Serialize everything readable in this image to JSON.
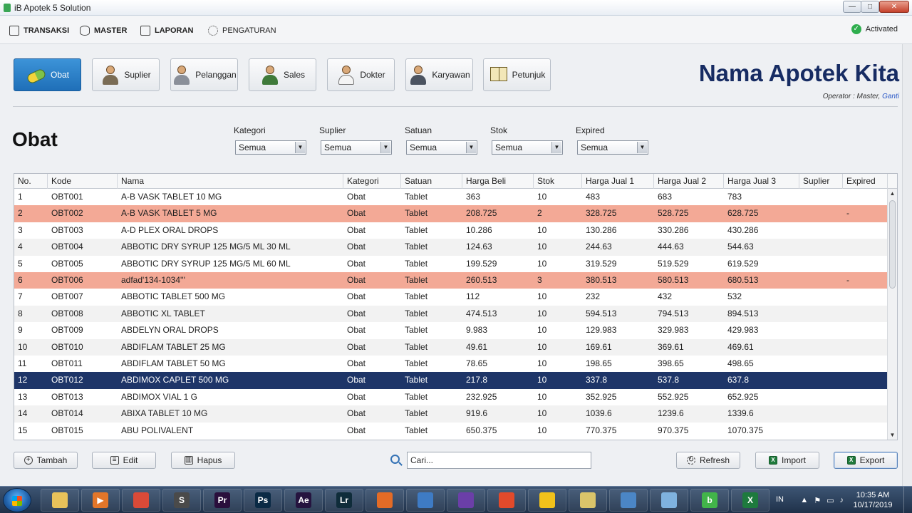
{
  "window": {
    "title": "iB Apotek 5 Solution",
    "controls": {
      "minimize": "—",
      "maximize": "□",
      "close": "✕"
    }
  },
  "menu": {
    "items": [
      {
        "label": "TRANSAKSI",
        "icon": "transaksi-icon"
      },
      {
        "label": "MASTER",
        "icon": "database-icon"
      },
      {
        "label": "LAPORAN",
        "icon": "report-icon"
      },
      {
        "label": "PENGATURAN",
        "icon": "gear-icon"
      }
    ],
    "status": "Activated"
  },
  "modules": [
    {
      "label": "Obat",
      "icon": "medicine-icon",
      "active": true
    },
    {
      "label": "Suplier",
      "icon": "supplier-icon"
    },
    {
      "label": "Pelanggan",
      "icon": "customer-icon"
    },
    {
      "label": "Sales",
      "icon": "sales-icon"
    },
    {
      "label": "Dokter",
      "icon": "doctor-icon"
    },
    {
      "label": "Karyawan",
      "icon": "employee-icon"
    },
    {
      "label": "Petunjuk",
      "icon": "guide-book-icon"
    }
  ],
  "brand": {
    "name": "Nama Apotek Kita",
    "operator_text": "Operator : Master,",
    "change_link": "Ganti"
  },
  "page": {
    "title": "Obat"
  },
  "filters": [
    {
      "label": "Kategori",
      "value": "Semua"
    },
    {
      "label": "Suplier",
      "value": "Semua"
    },
    {
      "label": "Satuan",
      "value": "Semua"
    },
    {
      "label": "Stok",
      "value": "Semua"
    },
    {
      "label": "Expired",
      "value": "Semua"
    }
  ],
  "table": {
    "columns": [
      "No.",
      "Kode",
      "Nama",
      "Kategori",
      "Satuan",
      "Harga Beli",
      "Stok",
      "Harga Jual 1",
      "Harga Jual 2",
      "Harga Jual 3",
      "Suplier",
      "Expired"
    ],
    "rows": [
      [
        "1",
        "OBT001",
        "A-B VASK TABLET 10 MG",
        "Obat",
        "Tablet",
        "363",
        "10",
        "483",
        "683",
        "783",
        "",
        ""
      ],
      [
        "2",
        "OBT002",
        "A-B VASK TABLET 5 MG",
        "Obat",
        "Tablet",
        "208.725",
        "2",
        "328.725",
        "528.725",
        "628.725",
        "",
        "-"
      ],
      [
        "3",
        "OBT003",
        "A-D PLEX ORAL DROPS",
        "Obat",
        "Tablet",
        "10.286",
        "10",
        "130.286",
        "330.286",
        "430.286",
        "",
        ""
      ],
      [
        "4",
        "OBT004",
        "ABBOTIC DRY SYRUP 125 MG/5 ML 30 ML",
        "Obat",
        "Tablet",
        "124.63",
        "10",
        "244.63",
        "444.63",
        "544.63",
        "",
        ""
      ],
      [
        "5",
        "OBT005",
        "ABBOTIC DRY SYRUP 125 MG/5 ML 60 ML",
        "Obat",
        "Tablet",
        "199.529",
        "10",
        "319.529",
        "519.529",
        "619.529",
        "",
        ""
      ],
      [
        "6",
        "OBT006",
        "adfad'134-1034'''",
        "Obat",
        "Tablet",
        "260.513",
        "3",
        "380.513",
        "580.513",
        "680.513",
        "",
        "-"
      ],
      [
        "7",
        "OBT007",
        "ABBOTIC TABLET 500 MG",
        "Obat",
        "Tablet",
        "112",
        "10",
        "232",
        "432",
        "532",
        "",
        ""
      ],
      [
        "8",
        "OBT008",
        "ABBOTIC XL TABLET",
        "Obat",
        "Tablet",
        "474.513",
        "10",
        "594.513",
        "794.513",
        "894.513",
        "",
        ""
      ],
      [
        "9",
        "OBT009",
        "ABDELYN ORAL DROPS",
        "Obat",
        "Tablet",
        "9.983",
        "10",
        "129.983",
        "329.983",
        "429.983",
        "",
        ""
      ],
      [
        "10",
        "OBT010",
        "ABDIFLAM TABLET 25 MG",
        "Obat",
        "Tablet",
        "49.61",
        "10",
        "169.61",
        "369.61",
        "469.61",
        "",
        ""
      ],
      [
        "11",
        "OBT011",
        "ABDIFLAM TABLET 50 MG",
        "Obat",
        "Tablet",
        "78.65",
        "10",
        "198.65",
        "398.65",
        "498.65",
        "",
        ""
      ],
      [
        "12",
        "OBT012",
        "ABDIMOX CAPLET 500 MG",
        "Obat",
        "Tablet",
        "217.8",
        "10",
        "337.8",
        "537.8",
        "637.8",
        "",
        ""
      ],
      [
        "13",
        "OBT013",
        "ABDIMOX VIAL 1 G",
        "Obat",
        "Tablet",
        "232.925",
        "10",
        "352.925",
        "552.925",
        "652.925",
        "",
        ""
      ],
      [
        "14",
        "OBT014",
        "ABIXA TABLET 10 MG",
        "Obat",
        "Tablet",
        "919.6",
        "10",
        "1039.6",
        "1239.6",
        "1339.6",
        "",
        ""
      ],
      [
        "15",
        "OBT015",
        "ABU POLIVALENT",
        "Obat",
        "Tablet",
        "650.375",
        "10",
        "770.375",
        "970.375",
        "1070.375",
        "",
        ""
      ]
    ],
    "low_stock_rows": [
      2,
      6
    ],
    "selected_row": 12
  },
  "actions": {
    "add": "Tambah",
    "edit": "Edit",
    "delete": "Hapus",
    "search_placeholder": "Cari...",
    "refresh": "Refresh",
    "import": "Import",
    "export": "Export"
  },
  "taskbar": {
    "apps": [
      {
        "name": "file-explorer-icon",
        "glyph": "",
        "color": "#e8c25a"
      },
      {
        "name": "media-player-icon",
        "glyph": "▶",
        "color": "#e2762a"
      },
      {
        "name": "chrome-icon",
        "glyph": "",
        "color": "#d94a38"
      },
      {
        "name": "sublime-text-icon",
        "glyph": "S",
        "color": "#4a4a4a"
      },
      {
        "name": "premiere-icon",
        "glyph": "Pr",
        "color": "#2a0f3c"
      },
      {
        "name": "photoshop-icon",
        "glyph": "Ps",
        "color": "#0a2a45"
      },
      {
        "name": "after-effects-icon",
        "glyph": "Ae",
        "color": "#25143f"
      },
      {
        "name": "lightroom-icon",
        "glyph": "Lr",
        "color": "#0f2c3a"
      },
      {
        "name": "firefox-icon",
        "glyph": "",
        "color": "#e36b26"
      },
      {
        "name": "virtualbox-icon",
        "glyph": "",
        "color": "#3e7bc4"
      },
      {
        "name": "visual-studio-icon",
        "glyph": "",
        "color": "#6b3fa8"
      },
      {
        "name": "codeigniter-icon",
        "glyph": "",
        "color": "#e24a2b"
      },
      {
        "name": "windows-app-icon",
        "glyph": "",
        "color": "#f1c21b"
      },
      {
        "name": "folder-icon",
        "glyph": "",
        "color": "#d9c46a"
      },
      {
        "name": "remote-desktop-icon",
        "glyph": "",
        "color": "#4b86c6"
      },
      {
        "name": "notepad-icon",
        "glyph": "",
        "color": "#7fb2df"
      },
      {
        "name": "ib-apotek-icon",
        "glyph": "b",
        "color": "#42b44a"
      },
      {
        "name": "excel-icon",
        "glyph": "X",
        "color": "#1e7a3e"
      }
    ],
    "language": "IN",
    "time": "10:35 AM",
    "date": "10/17/2019"
  }
}
